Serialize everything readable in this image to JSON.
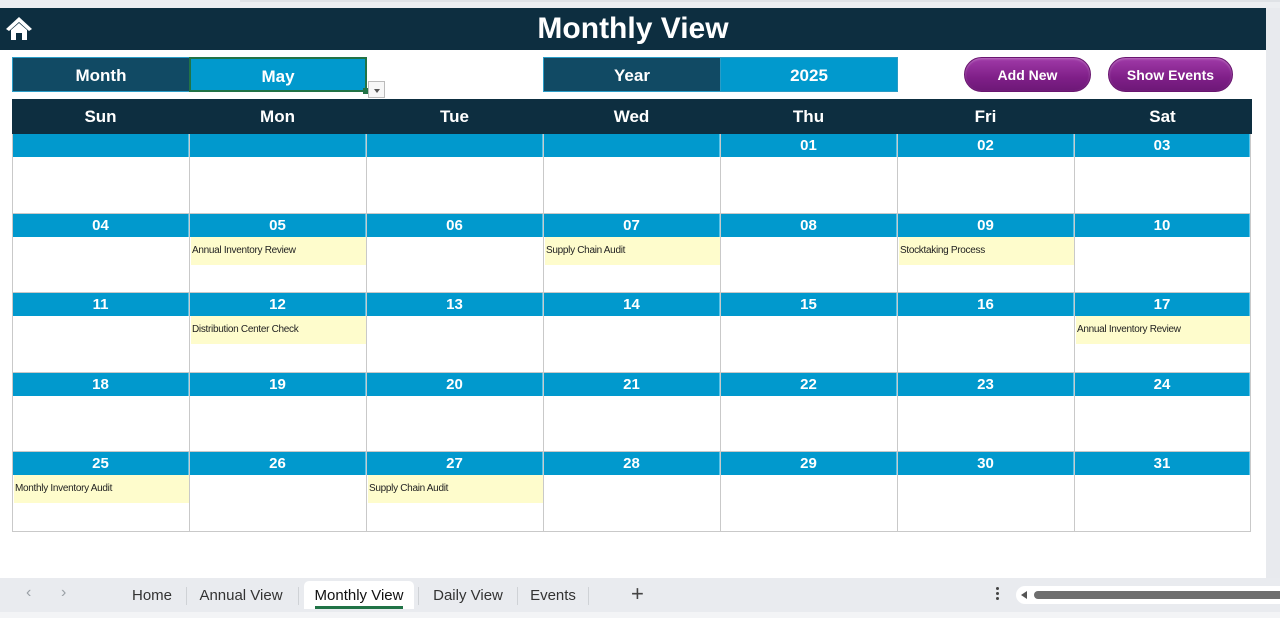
{
  "app": {
    "title": "Monthly View"
  },
  "controls": {
    "month_label": "Month",
    "month_value": "May",
    "year_label": "Year",
    "year_value": "2025",
    "add_new": "Add New",
    "show_events": "Show Events"
  },
  "calendar": {
    "weekdays": [
      "Sun",
      "Mon",
      "Tue",
      "Wed",
      "Thu",
      "Fri",
      "Sat"
    ],
    "weeks": [
      [
        {
          "date": "",
          "event": ""
        },
        {
          "date": "",
          "event": ""
        },
        {
          "date": "",
          "event": ""
        },
        {
          "date": "",
          "event": ""
        },
        {
          "date": "01",
          "event": ""
        },
        {
          "date": "02",
          "event": ""
        },
        {
          "date": "03",
          "event": ""
        }
      ],
      [
        {
          "date": "04",
          "event": ""
        },
        {
          "date": "05",
          "event": "Annual Inventory Review"
        },
        {
          "date": "06",
          "event": ""
        },
        {
          "date": "07",
          "event": "Supply Chain Audit"
        },
        {
          "date": "08",
          "event": ""
        },
        {
          "date": "09",
          "event": "Stocktaking Process"
        },
        {
          "date": "10",
          "event": ""
        }
      ],
      [
        {
          "date": "11",
          "event": ""
        },
        {
          "date": "12",
          "event": "Distribution Center Check"
        },
        {
          "date": "13",
          "event": ""
        },
        {
          "date": "14",
          "event": ""
        },
        {
          "date": "15",
          "event": ""
        },
        {
          "date": "16",
          "event": ""
        },
        {
          "date": "17",
          "event": "Annual Inventory Review"
        }
      ],
      [
        {
          "date": "18",
          "event": ""
        },
        {
          "date": "19",
          "event": ""
        },
        {
          "date": "20",
          "event": ""
        },
        {
          "date": "21",
          "event": ""
        },
        {
          "date": "22",
          "event": ""
        },
        {
          "date": "23",
          "event": ""
        },
        {
          "date": "24",
          "event": ""
        }
      ],
      [
        {
          "date": "25",
          "event": "Monthly Inventory Audit"
        },
        {
          "date": "26",
          "event": ""
        },
        {
          "date": "27",
          "event": "Supply Chain Audit"
        },
        {
          "date": "28",
          "event": ""
        },
        {
          "date": "29",
          "event": ""
        },
        {
          "date": "30",
          "event": ""
        },
        {
          "date": "31",
          "event": ""
        }
      ]
    ]
  },
  "sheet_tabs": {
    "tabs": [
      "Home",
      "Annual View",
      "Monthly View",
      "Daily View",
      "Events"
    ],
    "active": "Monthly View",
    "add_label": "+",
    "prev_icon": "‹",
    "next_icon": "›"
  },
  "colors": {
    "header_dark": "#0d2e40",
    "accent_blue": "#0199cd",
    "button_purple": "#8a2592",
    "event_fill": "#fefccc",
    "selection_green": "#217346"
  }
}
